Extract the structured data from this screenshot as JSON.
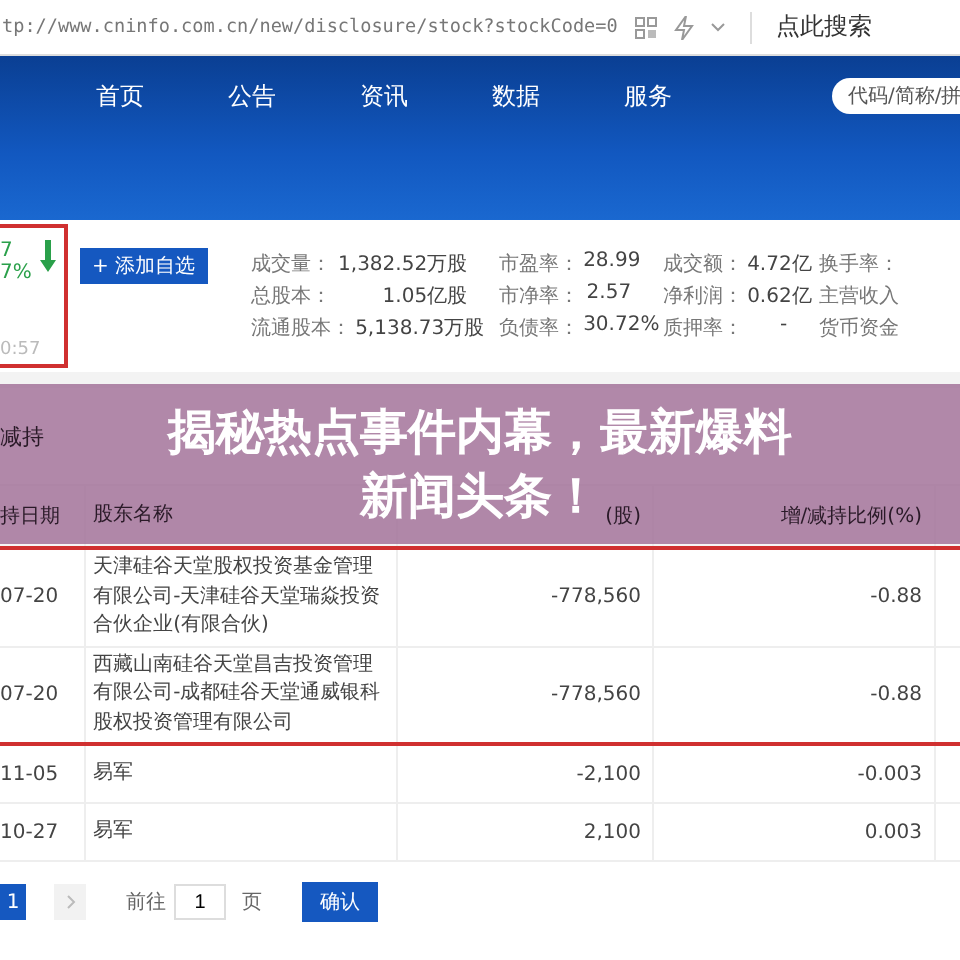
{
  "address_bar": {
    "url": "tp://www.cninfo.com.cn/new/disclosure/stock?stockCode=0",
    "search_label": "点此搜索"
  },
  "nav": {
    "items": [
      {
        "label": "首页"
      },
      {
        "label": "公告"
      },
      {
        "label": "资讯"
      },
      {
        "label": "数据"
      },
      {
        "label": "服务"
      }
    ],
    "search": {
      "placeholder": "代码/简称/拼"
    }
  },
  "quote": {
    "price": "7",
    "change": "7%",
    "time": "0:57",
    "add_button": "+ 添加自选"
  },
  "stats": [
    {
      "label": "成交量：",
      "value": "1,382.52万股"
    },
    {
      "label": "总股本：",
      "value": "1.05亿股"
    },
    {
      "label": "流通股本：",
      "value": "5,138.73万股"
    },
    {
      "label": "市盈率：",
      "value": "28.99"
    },
    {
      "label": "市净率：",
      "value": "2.57"
    },
    {
      "label": "负债率：",
      "value": "30.72%"
    },
    {
      "label": "成交额：",
      "value": "4.72亿"
    },
    {
      "label": "净利润：",
      "value": "0.62亿"
    },
    {
      "label": "质押率：",
      "value": "-"
    },
    {
      "label": "换手率："
    },
    {
      "label": "主营收入"
    },
    {
      "label": "货币资金"
    }
  ],
  "section_title": "减持",
  "table": {
    "columns": [
      "持日期",
      "股东名称",
      "(股)",
      "增/减持比例(%)"
    ],
    "rows": [
      {
        "date": "07-20",
        "holder": "天津硅谷天堂股权投资基金管理有限公司-天津硅谷天堂瑞焱投资合伙企业(有限合伙)",
        "shares": "-778,560",
        "ratio": "-0.88"
      },
      {
        "date": "07-20",
        "holder": "西藏山南硅谷天堂昌吉投资管理有限公司-成都硅谷天堂通威银科股权投资管理有限公司",
        "shares": "-778,560",
        "ratio": "-0.88"
      },
      {
        "date": "11-05",
        "holder": "易军",
        "shares": "-2,100",
        "ratio": "-0.003"
      },
      {
        "date": "10-27",
        "holder": "易军",
        "shares": "2,100",
        "ratio": "0.003"
      }
    ]
  },
  "pagination": {
    "pages": [
      {
        "label": "1",
        "selected": true
      }
    ],
    "goto_label": "前往",
    "page_input": "1",
    "page_unit": "页",
    "confirm": "确认"
  },
  "banner": {
    "lines": [
      "揭秘热点事件内幕，最新爆料",
      "新闻头条！"
    ]
  }
}
